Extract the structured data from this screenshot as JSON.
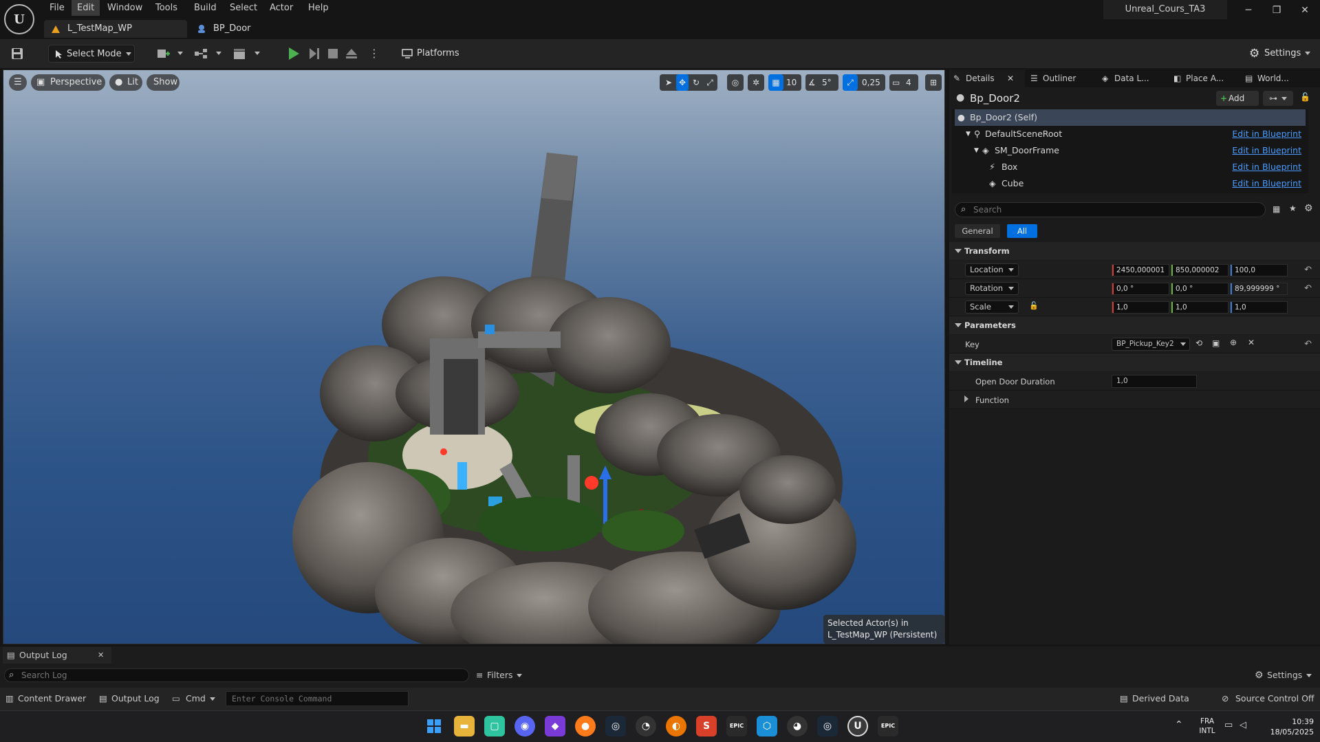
{
  "menu": {
    "items": [
      "File",
      "Edit",
      "Window",
      "Tools",
      "Build",
      "Select",
      "Actor",
      "Help"
    ],
    "active": "Edit"
  },
  "tabs": [
    {
      "label": "L_TestMap_WP"
    },
    {
      "label": "BP_Door"
    }
  ],
  "window": {
    "project": "Unreal_Cours_TA3",
    "minimize": "─",
    "restore": "❐",
    "close": "✕"
  },
  "toolbar": {
    "select_mode": "Select Mode",
    "platforms": "Platforms",
    "settings": "Settings"
  },
  "viewport": {
    "perspective": "Perspective",
    "lit": "Lit",
    "show": "Show",
    "grid_value": "10",
    "angle_value": "5°",
    "scale_value": "0,25",
    "camera_speed": "4",
    "selected_info_line1": "Selected Actor(s) in",
    "selected_info_line2": "L_TestMap_WP (Persistent)"
  },
  "details": {
    "tabs": [
      {
        "label": "Details"
      },
      {
        "label": "Outliner"
      },
      {
        "label": "Data L..."
      },
      {
        "label": "Place A..."
      },
      {
        "label": "World..."
      }
    ],
    "actor_name": "Bp_Door2",
    "add_label": "Add",
    "components": [
      {
        "label": "Bp_Door2 (Self)",
        "action": ""
      },
      {
        "label": "DefaultSceneRoot",
        "action": "Edit in Blueprint"
      },
      {
        "label": "SM_DoorFrame",
        "action": "Edit in Blueprint"
      },
      {
        "label": "Box",
        "action": "Edit in Blueprint"
      },
      {
        "label": "Cube",
        "action": "Edit in Blueprint"
      }
    ],
    "search_placeholder": "Search",
    "filters": {
      "general": "General",
      "all": "All"
    },
    "transform": {
      "header": "Transform",
      "location": {
        "label": "Location",
        "x": "2450,000001",
        "y": "850,000002",
        "z": "100,0"
      },
      "rotation": {
        "label": "Rotation",
        "x": "0,0 °",
        "y": "0,0 °",
        "z": "89,999999 °"
      },
      "scale": {
        "label": "Scale",
        "x": "1,0",
        "y": "1,0",
        "z": "1,0"
      }
    },
    "parameters": {
      "header": "Parameters",
      "key_label": "Key",
      "key_value": "BP_Pickup_Key2"
    },
    "timeline": {
      "header": "Timeline",
      "duration_label": "Open Door Duration",
      "duration_value": "1,0",
      "function_label": "Function"
    }
  },
  "output_log": {
    "tab": "Output Log",
    "search_placeholder": "Search Log",
    "filters": "Filters",
    "settings": "Settings"
  },
  "statusbar": {
    "content_drawer": "Content Drawer",
    "output_log": "Output Log",
    "cmd": "Cmd",
    "console_placeholder": "Enter Console Command",
    "derived_data": "Derived Data",
    "source_control": "Source Control Off"
  },
  "taskbar": {
    "lang1": "FRA",
    "lang2": "INTL",
    "time": "10:39",
    "date": "18/05/2025"
  },
  "colors": {
    "accent": "#0070e0",
    "link": "#4c9cff",
    "play": "#4caf50"
  }
}
